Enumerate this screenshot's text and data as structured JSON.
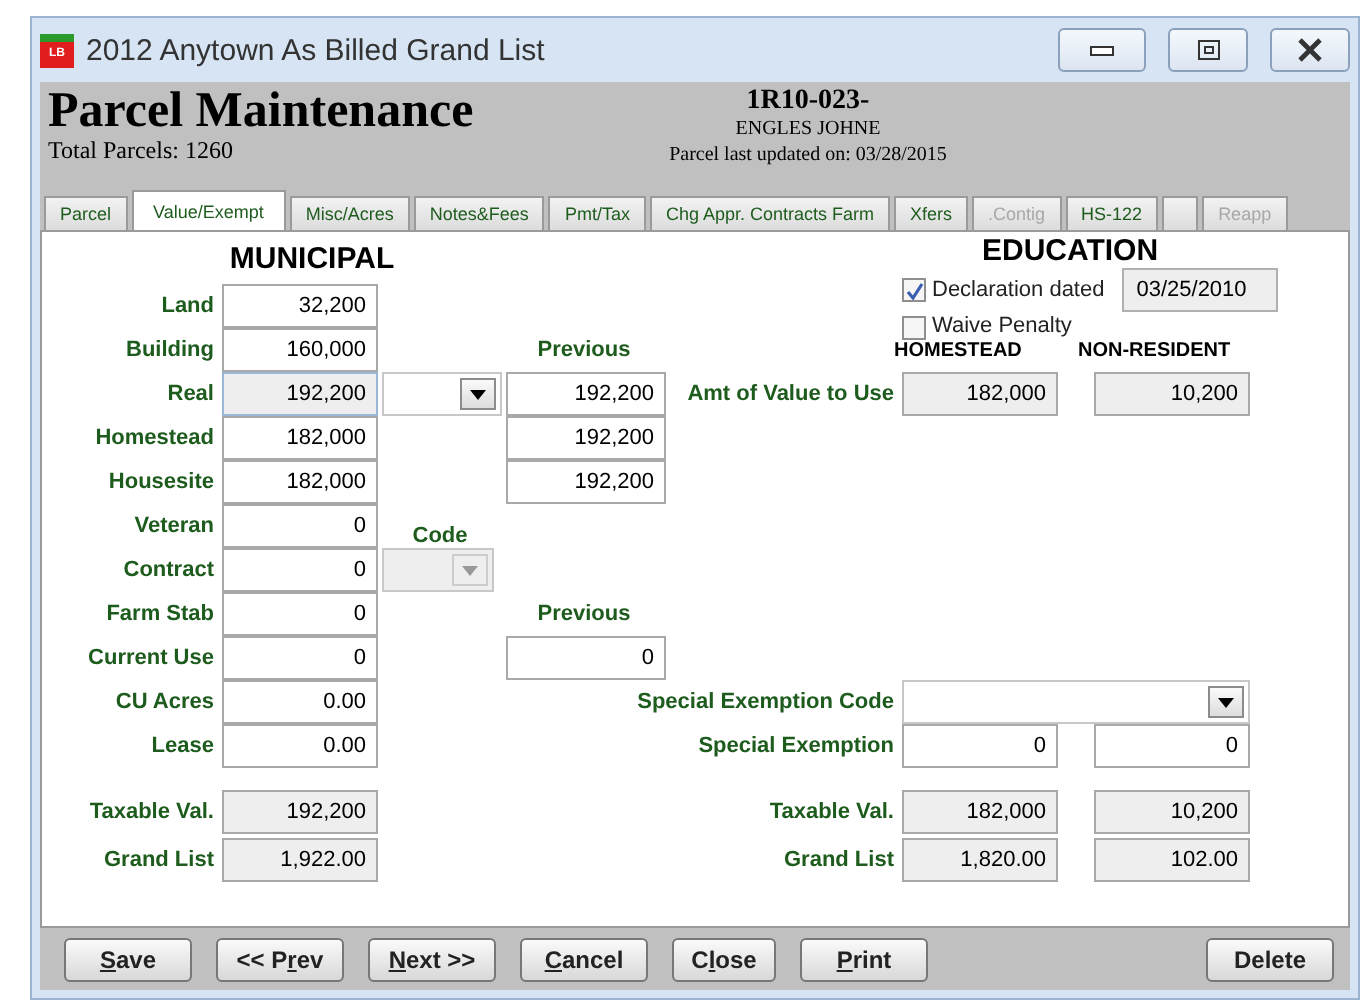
{
  "window": {
    "title": "2012 Anytown As Billed Grand List",
    "icon_text": "LB"
  },
  "header": {
    "title": "Parcel Maintenance",
    "total": "Total Parcels: 1260",
    "parcel_id": "1R10-023-",
    "owner": "ENGLES JOHNE",
    "updated": "Parcel last updated on: 03/28/2015"
  },
  "tabs": [
    {
      "label": "Parcel",
      "selected": false,
      "disabled": false
    },
    {
      "label": "Value/Exempt",
      "selected": true,
      "disabled": false
    },
    {
      "label": "Misc/Acres",
      "selected": false,
      "disabled": false
    },
    {
      "label": "Notes&Fees",
      "selected": false,
      "disabled": false
    },
    {
      "label": "Pmt/Tax",
      "selected": false,
      "disabled": false
    },
    {
      "label": "Chg Appr. Contracts Farm",
      "selected": false,
      "disabled": false
    },
    {
      "label": "Xfers",
      "selected": false,
      "disabled": false
    },
    {
      "label": ".Contig",
      "selected": false,
      "disabled": true
    },
    {
      "label": "HS-122",
      "selected": false,
      "disabled": false
    },
    {
      "selected": false
    },
    {
      "label": "Reapp",
      "selected": false,
      "disabled": true
    }
  ],
  "municipal": {
    "title": "MUNICIPAL",
    "rows": [
      {
        "label": "Land",
        "value": "32,200",
        "readonly": false
      },
      {
        "label": "Building",
        "value": "160,000",
        "readonly": false
      },
      {
        "label": "Real",
        "value": "192,200",
        "readonly": true
      },
      {
        "label": "Homestead",
        "value": "182,000",
        "readonly": false
      },
      {
        "label": "Housesite",
        "value": "182,000",
        "readonly": false
      },
      {
        "label": "Veteran",
        "value": "0",
        "readonly": false
      },
      {
        "label": "Contract",
        "value": "0",
        "readonly": false
      },
      {
        "label": "Farm Stab",
        "value": "0",
        "readonly": false
      },
      {
        "label": "Current Use",
        "value": "0",
        "readonly": false
      },
      {
        "label": "CU Acres",
        "value": "0.00",
        "readonly": false
      },
      {
        "label": "Lease",
        "value": "0.00",
        "readonly": false
      }
    ],
    "totals": [
      {
        "label": "Taxable Val.",
        "value": "192,200"
      },
      {
        "label": "Grand List",
        "value": "1,922.00"
      }
    ]
  },
  "previous": {
    "label": "Previous",
    "values": [
      "192,200",
      "192,200",
      "192,200"
    ]
  },
  "code": {
    "label": "Code",
    "disabled": true
  },
  "previous_use": {
    "label": "Previous",
    "value": "0"
  },
  "education": {
    "title": "EDUCATION",
    "declaration": {
      "label": "Declaration dated",
      "checked": true,
      "date": "03/25/2010"
    },
    "waive": {
      "label": "Waive Penalty",
      "checked": false
    },
    "columns": [
      "HOMESTEAD",
      "NON-RESIDENT"
    ],
    "amount": {
      "label": "Amt of Value to Use",
      "values": [
        "182,000",
        "10,200"
      ]
    },
    "special_code": {
      "label": "Special Exemption Code"
    },
    "special": {
      "label": "Special Exemption",
      "values": [
        "0",
        "0"
      ]
    },
    "taxable": {
      "label": "Taxable Val.",
      "values": [
        "182,000",
        "10,200"
      ]
    },
    "grand_list": {
      "label": "Grand List",
      "values": [
        "1,820.00",
        "102.00"
      ]
    }
  },
  "buttons": [
    {
      "key": "S",
      "after": "ave",
      "kind": "left"
    },
    {
      "before": "<< P",
      "key": "r",
      "after": "ev",
      "kind": "left"
    },
    {
      "key": "N",
      "after": "ext >>",
      "kind": "left"
    },
    {
      "key": "C",
      "after": "ancel",
      "kind": "left"
    },
    {
      "before": "C",
      "key": "l",
      "after": "ose",
      "kind": "left"
    },
    {
      "key": "P",
      "after": "rint",
      "kind": "left"
    },
    {
      "before": "Delete",
      "kind": "right"
    }
  ]
}
